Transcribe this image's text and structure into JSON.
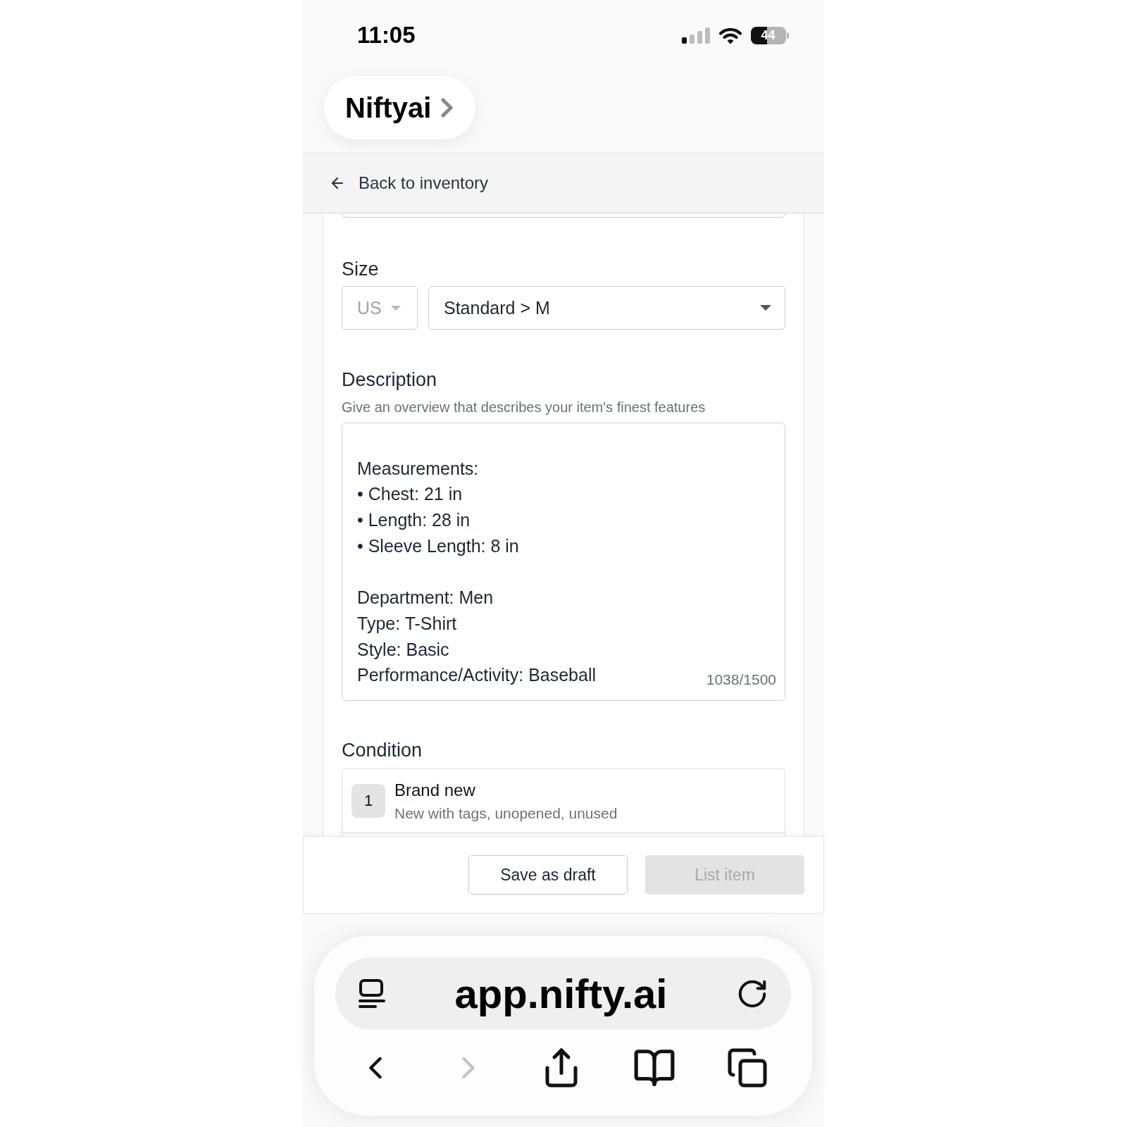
{
  "status_bar": {
    "time": "11:05",
    "battery": "44"
  },
  "site_menu": {
    "title": "Niftyai"
  },
  "back_link": {
    "label": "Back to inventory"
  },
  "size": {
    "label": "Size",
    "system": {
      "value": "US",
      "disabled": true
    },
    "value": {
      "value": "Standard > M",
      "disabled": false
    }
  },
  "description": {
    "label": "Description",
    "hint": "Give an overview that describes your item's finest features",
    "value": "Measurements:\n• Chest: 21 in\n• Length: 28 in\n• Sleeve Length: 8 in\n\nDepartment: Men\nType: T-Shirt\nStyle: Basic\nPerformance/Activity: Baseball",
    "count": "1038/1500"
  },
  "condition": {
    "label": "Condition",
    "options": [
      {
        "number": "1",
        "title": "Brand new",
        "detail": "New with tags, unopened, unused"
      }
    ]
  },
  "actions": [
    {
      "label": "Save as draft",
      "kind": "outline",
      "disabled": false
    },
    {
      "label": "List item",
      "kind": "solid",
      "disabled": true
    }
  ],
  "browser": {
    "url": "app.nifty.ai",
    "toolbar": [
      {
        "kind": "back",
        "disabled": false
      },
      {
        "kind": "forward",
        "disabled": true
      },
      {
        "kind": "share",
        "disabled": false
      },
      {
        "kind": "bookmarks",
        "disabled": false
      },
      {
        "kind": "tabs",
        "disabled": false
      }
    ]
  }
}
